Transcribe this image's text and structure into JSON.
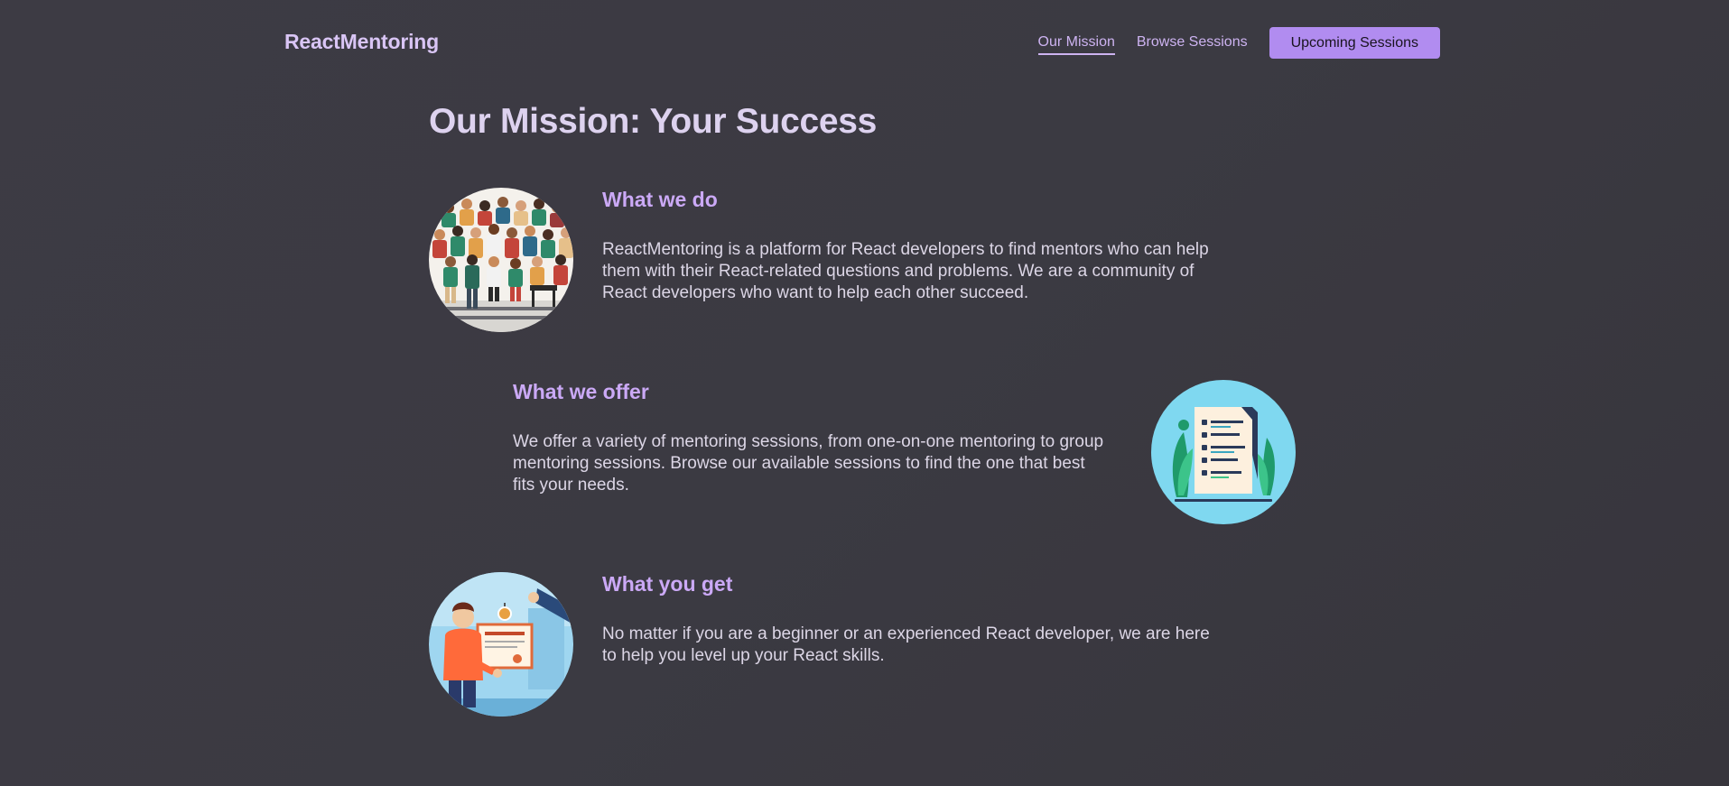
{
  "header": {
    "brand": "ReactMentoring",
    "nav": {
      "mission": "Our Mission",
      "browse": "Browse Sessions",
      "upcoming": "Upcoming Sessions"
    }
  },
  "main": {
    "title": "Our Mission: Your Success",
    "sections": [
      {
        "heading": "What we do",
        "text": "ReactMentoring is a platform for React developers to find mentors who can help them with their React-related questions and problems. We are a community of React developers who want to help each other succeed.",
        "image": "crowd-of-people-illustration"
      },
      {
        "heading": "What we offer",
        "text": "We offer a variety of mentoring sessions, from one-on-one mentoring to group mentoring sessions. Browse our available sessions to find the one that best fits your needs.",
        "image": "checklist-document-illustration"
      },
      {
        "heading": "What you get",
        "text": "No matter if you are a beginner or an experienced React developer, we are here to help you level up your React skills.",
        "image": "certificate-handover-illustration"
      }
    ]
  },
  "colors": {
    "background": "#3b3a42",
    "accent": "#b18cf0",
    "heading": "#cba9f6",
    "text": "#dcd6e6"
  }
}
